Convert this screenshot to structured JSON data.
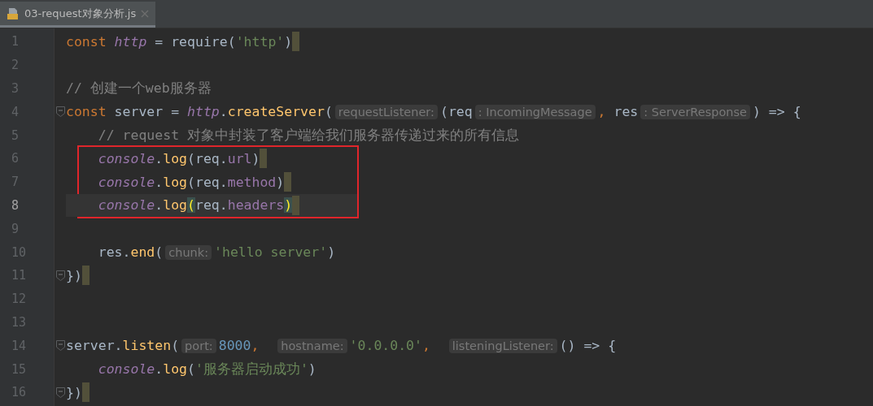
{
  "tabs": [
    {
      "label": "03-request对象分析.js",
      "selected": true
    }
  ],
  "lines": [
    {
      "number": "1",
      "current": false,
      "boxed": false,
      "fold": false,
      "end_mark": true,
      "tokens": [
        {
          "kind": "kw",
          "text": "const "
        },
        {
          "kind": "var",
          "text": "http"
        },
        {
          "kind": "id",
          "text": " = require("
        },
        {
          "kind": "str",
          "text": "'http'"
        },
        {
          "kind": "id",
          "text": ")"
        }
      ]
    },
    {
      "number": "2",
      "current": false,
      "boxed": false,
      "fold": false,
      "end_mark": false
    },
    {
      "number": "3",
      "current": false,
      "boxed": false,
      "fold": false,
      "end_mark": false,
      "tokens": [
        {
          "kind": "cm",
          "text": "// 创建一个web服务器"
        }
      ]
    },
    {
      "number": "4",
      "current": false,
      "boxed": false,
      "fold": true,
      "end_mark": false,
      "tokens": [
        {
          "kind": "kw",
          "text": "const "
        },
        {
          "kind": "id",
          "text": "server = "
        },
        {
          "kind": "var",
          "text": "http"
        },
        {
          "kind": "id",
          "text": "."
        },
        {
          "kind": "fn",
          "text": "createServer"
        },
        {
          "kind": "id",
          "text": "("
        },
        {
          "kind": "hint",
          "text": "requestListener:"
        },
        {
          "kind": "id",
          "text": "(req"
        },
        {
          "kind": "hint",
          "text": ": IncomingMessage"
        },
        {
          "kind": "comma",
          "text": ", "
        },
        {
          "kind": "id",
          "text": "res"
        },
        {
          "kind": "hint",
          "text": ": ServerResponse"
        },
        {
          "kind": "id",
          "text": ") => {"
        }
      ]
    },
    {
      "number": "5",
      "current": false,
      "boxed": false,
      "fold": false,
      "end_mark": false,
      "tokens": [
        {
          "kind": "cm",
          "text": "    // request 对象中封装了客户端给我们服务器传递过来的所有信息"
        }
      ]
    },
    {
      "number": "6",
      "current": false,
      "boxed": true,
      "fold": false,
      "end_mark": true,
      "tokens": [
        {
          "kind": "var",
          "text": "    console"
        },
        {
          "kind": "id",
          "text": "."
        },
        {
          "kind": "fn",
          "text": "log"
        },
        {
          "kind": "id",
          "text": "(req."
        },
        {
          "kind": "prop",
          "text": "url"
        },
        {
          "kind": "id",
          "text": ")"
        }
      ]
    },
    {
      "number": "7",
      "current": false,
      "boxed": true,
      "fold": false,
      "end_mark": true,
      "tokens": [
        {
          "kind": "var",
          "text": "    console"
        },
        {
          "kind": "id",
          "text": "."
        },
        {
          "kind": "fn",
          "text": "log"
        },
        {
          "kind": "id",
          "text": "(req."
        },
        {
          "kind": "prop",
          "text": "method"
        },
        {
          "kind": "id",
          "text": ")"
        }
      ]
    },
    {
      "number": "8",
      "current": true,
      "boxed": true,
      "fold": false,
      "end_mark": true,
      "tokens": [
        {
          "kind": "var",
          "text": "    console"
        },
        {
          "kind": "id",
          "text": "."
        },
        {
          "kind": "fn",
          "text": "log"
        },
        {
          "kind": "match",
          "text": "("
        },
        {
          "kind": "id",
          "text": "req."
        },
        {
          "kind": "prop",
          "text": "headers"
        },
        {
          "kind": "match",
          "text": ")"
        }
      ]
    },
    {
      "number": "9",
      "current": false,
      "boxed": false,
      "fold": false,
      "end_mark": false
    },
    {
      "number": "10",
      "current": false,
      "boxed": false,
      "fold": false,
      "end_mark": false,
      "tokens": [
        {
          "kind": "id",
          "text": "    res."
        },
        {
          "kind": "fn",
          "text": "end"
        },
        {
          "kind": "id",
          "text": "("
        },
        {
          "kind": "hint",
          "text": "chunk:"
        },
        {
          "kind": "str",
          "text": "'hello server'"
        },
        {
          "kind": "id",
          "text": ")"
        }
      ]
    },
    {
      "number": "11",
      "current": false,
      "boxed": false,
      "fold": true,
      "end_mark": true,
      "tokens": [
        {
          "kind": "id",
          "text": "})"
        }
      ]
    },
    {
      "number": "12",
      "current": false,
      "boxed": false,
      "fold": false,
      "end_mark": false
    },
    {
      "number": "13",
      "current": false,
      "boxed": false,
      "fold": false,
      "end_mark": false
    },
    {
      "number": "14",
      "current": false,
      "boxed": false,
      "fold": true,
      "end_mark": false,
      "tokens": [
        {
          "kind": "id",
          "text": "server."
        },
        {
          "kind": "fn",
          "text": "listen"
        },
        {
          "kind": "id",
          "text": "("
        },
        {
          "kind": "hint",
          "text": "port:"
        },
        {
          "kind": "num",
          "text": "8000"
        },
        {
          "kind": "comma",
          "text": ",  "
        },
        {
          "kind": "hint",
          "text": "hostname:"
        },
        {
          "kind": "str",
          "text": "'0.0.0.0'"
        },
        {
          "kind": "comma",
          "text": ",  "
        },
        {
          "kind": "hint",
          "text": "listeningListener:"
        },
        {
          "kind": "id",
          "text": "() => {"
        }
      ]
    },
    {
      "number": "15",
      "current": false,
      "boxed": false,
      "fold": false,
      "end_mark": false,
      "tokens": [
        {
          "kind": "var",
          "text": "    console"
        },
        {
          "kind": "id",
          "text": "."
        },
        {
          "kind": "fn",
          "text": "log"
        },
        {
          "kind": "id",
          "text": "("
        },
        {
          "kind": "str",
          "text": "'服务器启动成功'"
        },
        {
          "kind": "id",
          "text": ")"
        }
      ]
    },
    {
      "number": "16",
      "current": false,
      "boxed": false,
      "fold": true,
      "end_mark": true,
      "tokens": [
        {
          "kind": "id",
          "text": "})"
        }
      ]
    }
  ]
}
